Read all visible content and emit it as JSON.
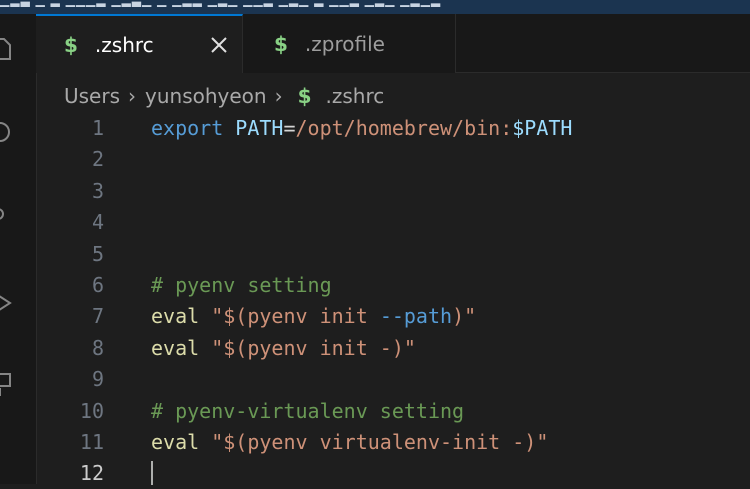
{
  "colors": {
    "keyword": "#569cd6",
    "variable": "#9cdcfe",
    "string": "#ce9178",
    "comment": "#6a9955",
    "command": "#dcdcaa",
    "flag": "#569cd6",
    "plain": "#d4d4d4"
  },
  "tabs": [
    {
      "icon": "$",
      "label": ".zshrc",
      "active": true
    },
    {
      "icon": "$",
      "label": ".zprofile",
      "active": false
    }
  ],
  "breadcrumb": {
    "items": [
      "Users",
      "yunsohyeon"
    ],
    "file_icon": "$",
    "file": ".zshrc"
  },
  "editor": {
    "current_line": "12",
    "lines": [
      {
        "num": "1",
        "tokens": [
          [
            "export",
            "keyword"
          ],
          [
            " ",
            "plain"
          ],
          [
            "PATH",
            "variable"
          ],
          [
            "=",
            "plain"
          ],
          [
            "/opt/homebrew/bin:",
            "string"
          ],
          [
            "$PATH",
            "variable"
          ]
        ]
      },
      {
        "num": "2",
        "tokens": []
      },
      {
        "num": "3",
        "tokens": []
      },
      {
        "num": "4",
        "tokens": []
      },
      {
        "num": "5",
        "tokens": []
      },
      {
        "num": "6",
        "tokens": [
          [
            "# pyenv setting",
            "comment"
          ]
        ]
      },
      {
        "num": "7",
        "tokens": [
          [
            "eval",
            "command"
          ],
          [
            " ",
            "plain"
          ],
          [
            "\"$(pyenv ",
            "string"
          ],
          [
            "init",
            "string"
          ],
          [
            " ",
            "plain"
          ],
          [
            "--path",
            "flag"
          ],
          [
            ")\"",
            "string"
          ]
        ]
      },
      {
        "num": "8",
        "tokens": [
          [
            "eval",
            "command"
          ],
          [
            " ",
            "plain"
          ],
          [
            "\"$(pyenv ",
            "string"
          ],
          [
            "init",
            "string"
          ],
          [
            " -)\"",
            "string"
          ]
        ]
      },
      {
        "num": "9",
        "tokens": []
      },
      {
        "num": "10",
        "tokens": [
          [
            "# pyenv-virtualenv setting",
            "comment"
          ]
        ]
      },
      {
        "num": "11",
        "tokens": [
          [
            "eval",
            "command"
          ],
          [
            " ",
            "plain"
          ],
          [
            "\"$(pyenv ",
            "string"
          ],
          [
            "virtualenv-init",
            "string"
          ],
          [
            " -)\"",
            "string"
          ]
        ]
      },
      {
        "num": "12",
        "tokens": []
      }
    ]
  }
}
